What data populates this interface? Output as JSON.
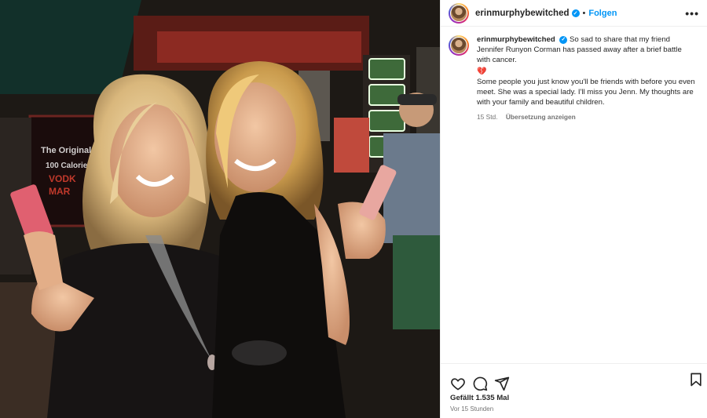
{
  "post": {
    "username": "erinmurphybewitched",
    "follow_label": "Folgen",
    "separator": "•",
    "more_label": "•••",
    "verified_mark": "✓"
  },
  "caption": {
    "username": "erinmurphybewitched",
    "text_1": "So sad to share that my friend Jennifer Runyon Corman has passed away after a brief battle with cancer.",
    "emoji": "💔",
    "text_2": "Some people you just know you'll be friends with before you even meet. She was a special lady. I'll miss you Jenn. My thoughts are with your family and beautiful children.",
    "age": "15 Std.",
    "translate_label": "Übersetzung anzeigen"
  },
  "footer": {
    "likes": "Gefällt 1.535 Mal",
    "timestamp": "Vor 15 Stunden"
  },
  "photo_sign": {
    "line1": "The Original",
    "line2": "100 Calorie",
    "line3": "VODK",
    "line4": "MAR"
  },
  "icons": {
    "like": "heart-icon",
    "comment": "comment-icon",
    "share": "paper-plane-icon",
    "save": "bookmark-icon"
  },
  "colors": {
    "accent": "#0095f6",
    "text": "#262626",
    "muted": "#737373",
    "heart": "#e0245e"
  }
}
